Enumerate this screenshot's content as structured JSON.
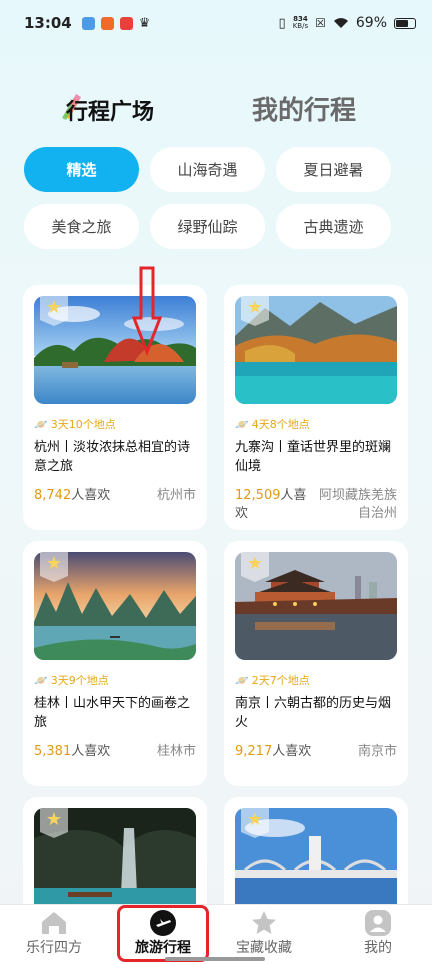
{
  "status_bar": {
    "time": "13:04",
    "net_speed_top": "834",
    "net_speed_bottom": "KB/s",
    "battery": "69%"
  },
  "header": {
    "tab_plaza": "行程广场",
    "tab_mine": "我的行程"
  },
  "categories": [
    {
      "label": "精选",
      "active": true
    },
    {
      "label": "山海奇遇",
      "active": false
    },
    {
      "label": "夏日避暑",
      "active": false
    },
    {
      "label": "美食之旅",
      "active": false
    },
    {
      "label": "绿野仙踪",
      "active": false
    },
    {
      "label": "古典遗迹",
      "active": false
    }
  ],
  "cards": [
    {
      "meta": "3天10个地点",
      "title": "杭州丨淡妆浓抹总相宜的诗意之旅",
      "likes_num": "8,742",
      "likes_unit": "人喜欢",
      "city": "杭州市"
    },
    {
      "meta": "4天8个地点",
      "title": "九寨沟丨童话世界里的斑斓仙境",
      "likes_num": "12,509",
      "likes_unit": "人喜欢",
      "city": "阿坝藏族羌族自治州"
    },
    {
      "meta": "3天9个地点",
      "title": "桂林丨山水甲天下的画卷之旅",
      "likes_num": "5,381",
      "likes_unit": "人喜欢",
      "city": "桂林市"
    },
    {
      "meta": "2天7个地点",
      "title": "南京丨六朝古都的历史与烟火",
      "likes_num": "9,217",
      "likes_unit": "人喜欢",
      "city": "南京市"
    }
  ],
  "bottom_nav": [
    {
      "label": "乐行四方",
      "icon": "home-icon",
      "active": false
    },
    {
      "label": "旅游行程",
      "icon": "plane-icon",
      "active": true
    },
    {
      "label": "宝藏收藏",
      "icon": "star-icon",
      "active": false
    },
    {
      "label": "我的",
      "icon": "user-icon",
      "active": false
    }
  ],
  "colors": {
    "accent": "#12b1f0",
    "likes": "#e19a14",
    "annotation": "#e4262b"
  }
}
